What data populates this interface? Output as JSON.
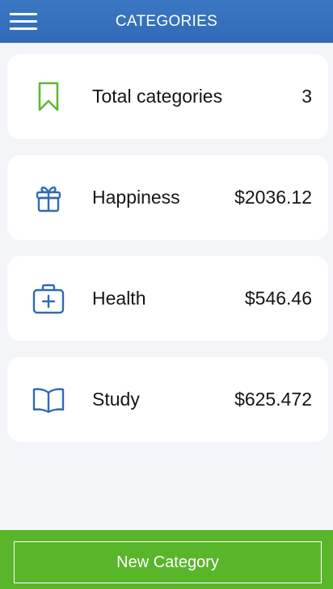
{
  "header": {
    "title": "CATEGORIES",
    "menu_icon": "hamburger-menu-icon"
  },
  "colors": {
    "header_bg": "#2f6ab6",
    "page_bg": "#f3f5f8",
    "accent_green": "#59b52a",
    "icon_blue": "#2f6ab6",
    "icon_green": "#5cb82e"
  },
  "summary": {
    "label": "Total categories",
    "value": "3",
    "icon": "bookmark-icon"
  },
  "categories": [
    {
      "label": "Happiness",
      "value": "$2036.12",
      "icon": "gift-icon"
    },
    {
      "label": "Health",
      "value": "$546.46",
      "icon": "medical-kit-icon"
    },
    {
      "label": "Study",
      "value": "$625.472",
      "icon": "open-book-icon"
    }
  ],
  "footer": {
    "new_category_label": "New Category"
  }
}
